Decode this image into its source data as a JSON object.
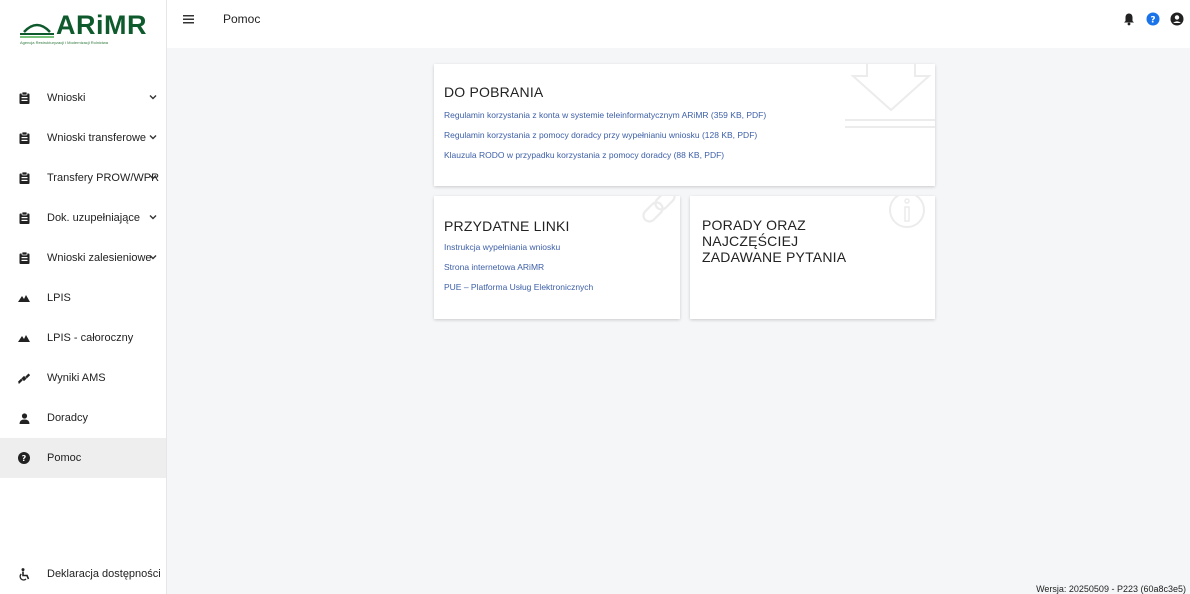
{
  "logo": {
    "name": "ARiMR",
    "subtitle": "Agencja Restrukturyzacji i Modernizacji Rolnictwa",
    "color": "#0e5a2d"
  },
  "topbar": {
    "title": "Pomoc"
  },
  "sidebar": {
    "items": [
      {
        "label": "Wnioski",
        "icon": "clipboard-icon",
        "expandable": true
      },
      {
        "label": "Wnioski transferowe",
        "icon": "clipboard-icon",
        "expandable": true
      },
      {
        "label": "Transfery PROW/WPR",
        "icon": "clipboard-icon",
        "expandable": true
      },
      {
        "label": "Dok. uzupełniające",
        "icon": "clipboard-icon",
        "expandable": true
      },
      {
        "label": "Wnioski zalesieniowe",
        "icon": "clipboard-icon",
        "expandable": true
      },
      {
        "label": "LPIS",
        "icon": "mountain-icon",
        "expandable": false
      },
      {
        "label": "LPIS - całoroczny",
        "icon": "mountain-icon",
        "expandable": false
      },
      {
        "label": "Wyniki AMS",
        "icon": "satellite-icon",
        "expandable": false
      },
      {
        "label": "Doradcy",
        "icon": "user-icon",
        "expandable": false
      },
      {
        "label": "Pomoc",
        "icon": "question-circle-icon",
        "expandable": false,
        "active": true
      }
    ],
    "bottom_item": {
      "label": "Deklaracja dostępności",
      "icon": "accessibility-icon"
    }
  },
  "download": {
    "title": "DO POBRANIA",
    "links": [
      "Regulamin korzystania z konta w systemie teleinformatycznym ARiMR (359 KB, PDF)",
      "Regulamin korzystania z pomocy doradcy przy wypełnianiu wniosku (128 KB, PDF)",
      "Klauzula RODO w przypadku korzystania z pomocy doradcy (88 KB, PDF)"
    ]
  },
  "useful_links": {
    "title": "PRZYDATNE LINKI",
    "links": [
      "Instrukcja wypełniania wniosku",
      "Strona internetowa ARiMR",
      "PUE – Platforma Usług Elektronicznych"
    ]
  },
  "faq": {
    "title": "PORADY ORAZ NAJCZĘŚCIEJ ZADAWANE PYTANIA"
  },
  "footer": {
    "version": "Wersja: 20250509 - P223 (60a8c3e5)"
  },
  "colors": {
    "link": "#3d5fa8",
    "accent": "#1a73e8",
    "brand": "#0e5a2d"
  }
}
